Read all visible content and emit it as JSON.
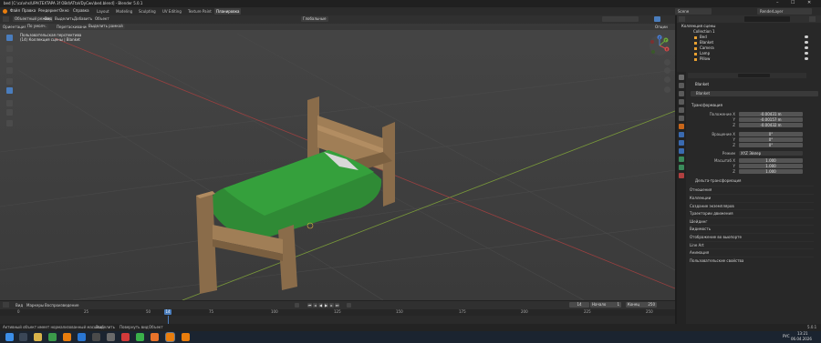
{
  "window": {
    "title": "bed [C:\\ca\\vhs\\UPA\\TEXTAPA 3f OBd\\ATtaVDyCwv\\bed.blend] - Blender 5.0.1",
    "minimize": "–",
    "maximize": "☐",
    "close": "✕"
  },
  "menubar": {
    "items": [
      "Файл",
      "Правка",
      "Рендеринг",
      "Окно",
      "Справка"
    ],
    "workspaces": [
      "Layout",
      "Modeling",
      "Sculpting",
      "UV Editing",
      "Texture Paint",
      "Shading",
      "Animation",
      "Rendering",
      "Compositing",
      "Geometry Nodes",
      "Scripting",
      "Планировка"
    ],
    "active_workspace": "Планировка",
    "scene": "Scene",
    "view_layer": "RenderLayer"
  },
  "viewport": {
    "mode": "Объектный режим",
    "menus": [
      "Вид",
      "Выделить",
      "Добавить",
      "Объект"
    ],
    "orientation_label": "Ориентация:",
    "orientation_value": "По умолч.",
    "drag_label": "Перетаскивание:",
    "drag_value": "Выделить рамкой",
    "transform_global": "Глобальные",
    "options": "Опции",
    "overlay_line1": "Пользовательская перспектива",
    "overlay_line2": "(14) Коллекция сцены | Blanket"
  },
  "gizmo": {
    "x": "X",
    "y": "Y",
    "z": "Z"
  },
  "timeline": {
    "menus": [
      "Вид",
      "Маркеры",
      "Воспроизведение"
    ],
    "ticks": [
      "0",
      "25",
      "50",
      "75",
      "100",
      "125",
      "150",
      "175",
      "200",
      "225",
      "250"
    ],
    "current_frame": "14",
    "frame_field": "14",
    "start_label": "Начало",
    "start_value": "1",
    "end_label": "Конец",
    "end_value": "250"
  },
  "status": {
    "left": "Активный объект имеет нормализованный масштаб",
    "select": "Выделить",
    "rotate": "Повернуть вид",
    "object": "Объект",
    "version": "5.0.1"
  },
  "taskbar": {
    "time": "13:21",
    "date": "06.04.2026",
    "lang": "РУС"
  },
  "outliner": {
    "search_placeholder": "",
    "root": "Коллекция сцены",
    "collection": "Collection 1",
    "items": [
      "Bed",
      "Blanket",
      "Camera",
      "Lamp",
      "Pillow"
    ]
  },
  "properties": {
    "object_name": "Blanket",
    "data_name": "Blanket",
    "transform_label": "Трансформация",
    "location_label": "Положение X",
    "location": [
      "-0.00431 m",
      "-0.00157 m",
      "-0.00432 m"
    ],
    "rotation_label": "Вращение X",
    "rotation": [
      "0°",
      "0°",
      "0°"
    ],
    "mode_label": "Режим",
    "mode_value": "XYZ Эйлер",
    "scale_label": "Масштаб X",
    "scale": [
      "1.000",
      "1.000",
      "1.000"
    ],
    "axis_y": "Y",
    "axis_z": "Z",
    "delta": "Дельта-трансформация",
    "sections": [
      "Отношения",
      "Коллекции",
      "Создание экземпляров",
      "Траектории движения",
      "Шейдинг",
      "Видимость",
      "Отображение во вьюпорте",
      "Line Art",
      "Анимация",
      "Пользовательские свойства"
    ]
  }
}
